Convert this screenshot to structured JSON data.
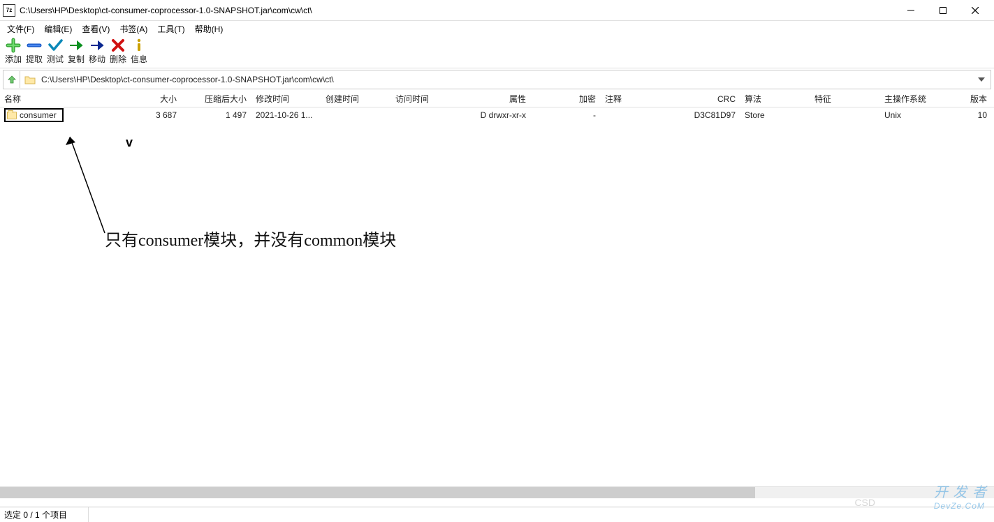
{
  "window": {
    "title": "C:\\Users\\HP\\Desktop\\ct-consumer-coprocessor-1.0-SNAPSHOT.jar\\com\\cw\\ct\\",
    "app_icon_text": "7z"
  },
  "menu": {
    "file": "文件(F)",
    "edit": "编辑(E)",
    "view": "查看(V)",
    "bookmarks": "书签(A)",
    "tools": "工具(T)",
    "help": "帮助(H)"
  },
  "toolbar": {
    "add": "添加",
    "extract": "提取",
    "test": "测试",
    "copy": "复制",
    "move": "移动",
    "delete": "删除",
    "info": "信息"
  },
  "addressbar": {
    "path": "C:\\Users\\HP\\Desktop\\ct-consumer-coprocessor-1.0-SNAPSHOT.jar\\com\\cw\\ct\\"
  },
  "columns": {
    "name": "名称",
    "size": "大小",
    "packed_size": "压缩后大小",
    "mtime": "修改时间",
    "ctime": "创建时间",
    "atime": "访问时间",
    "attr": "属性",
    "encrypt": "加密",
    "comment": "注释",
    "crc": "CRC",
    "algo": "算法",
    "feature": "特征",
    "os": "主操作系统",
    "version": "版本"
  },
  "rows": [
    {
      "name": "consumer",
      "size": "3 687",
      "packed_size": "1 497",
      "mtime": "2021-10-26 1...",
      "ctime": "",
      "atime": "",
      "attr": "D drwxr-xr-x",
      "encrypt": "-",
      "comment": "",
      "crc": "D3C81D97",
      "algo": "Store",
      "feature": "",
      "os": "Unix",
      "version": "10"
    }
  ],
  "annotation": {
    "text": "只有consumer模块，并没有common模块"
  },
  "status": {
    "selection": "选定 0 / 1 个项目"
  },
  "watermark": {
    "brand": "DevZe.CoM",
    "sub": "开 发 者",
    "csdn": "CSD"
  }
}
